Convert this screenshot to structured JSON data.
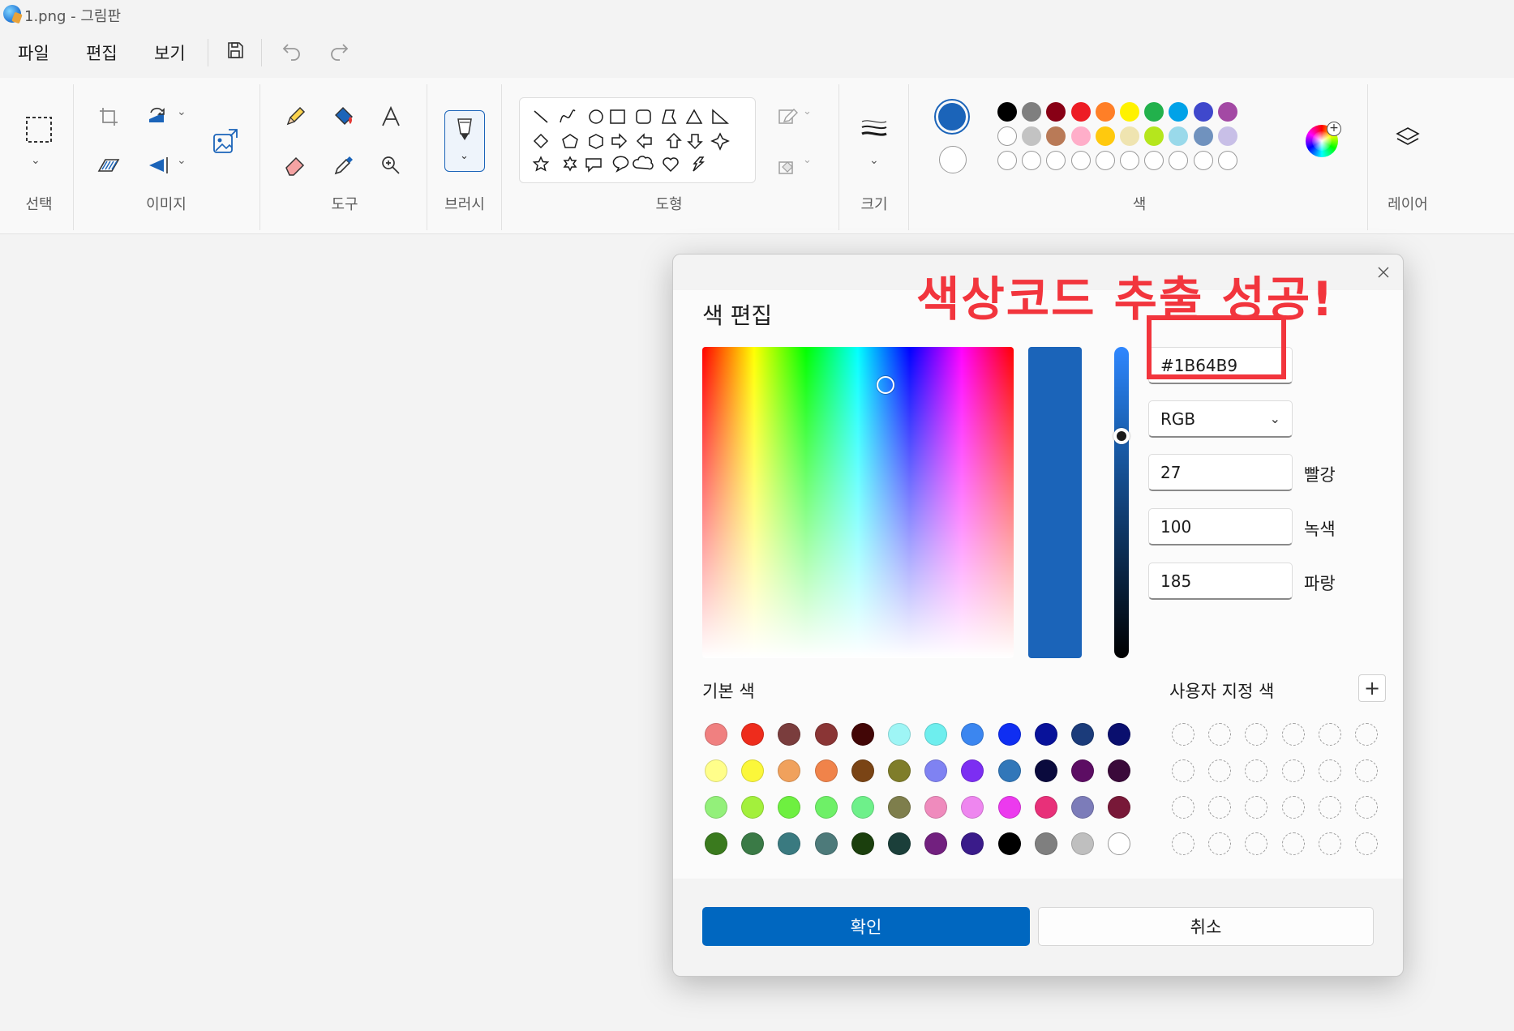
{
  "window": {
    "title": "1.png - 그림판"
  },
  "menu": {
    "file": "파일",
    "edit": "편집",
    "view": "보기"
  },
  "ribbon": {
    "groups": {
      "select": "선택",
      "image": "이미지",
      "tools": "도구",
      "brush": "브러시",
      "shapes": "도형",
      "size": "크기",
      "colors": "색",
      "layers": "레이어"
    }
  },
  "palette": {
    "primary": "#1b64b9",
    "secondary": "#ffffff",
    "row1": [
      "#000000",
      "#7f7f7f",
      "#880015",
      "#ed1c24",
      "#ff7f27",
      "#fff200",
      "#22b14c",
      "#00a2e8",
      "#3f48cc",
      "#a349a4"
    ],
    "row2": [
      "#ffffff",
      "#c3c3c3",
      "#b97a57",
      "#ffaec9",
      "#ffc90e",
      "#efe4b0",
      "#b5e61d",
      "#99d9ea",
      "#7092be",
      "#c8bfe7"
    ],
    "row3_count": 10
  },
  "dialog": {
    "title": "색 편집",
    "annotation": "색상코드 추출 성공!",
    "hex": "#1B64B9",
    "mode": "RGB",
    "red": {
      "value": "27",
      "label": "빨강"
    },
    "green": {
      "value": "100",
      "label": "녹색"
    },
    "blue": {
      "value": "185",
      "label": "파랑"
    },
    "preview_color": "#1b64b9",
    "basic_colors_label": "기본 색",
    "custom_colors_label": "사용자 지정 색",
    "basic_colors": [
      [
        "#f08080",
        "#ee2c1c",
        "#7a3d3d",
        "#8a3535",
        "#420606",
        "#9ef5f5",
        "#6eeeee",
        "#3b86f0",
        "#0f2ef2",
        "#08129a",
        "#1b3b7a",
        "#0a0f6e"
      ],
      [
        "#fffe8a",
        "#fbf73a",
        "#f0a15c",
        "#f0834a",
        "#7a4415",
        "#7f7d2a",
        "#7f82f2",
        "#7c2ef2",
        "#3177b9",
        "#0a0a3d",
        "#5c0d63",
        "#3a0a3a"
      ],
      [
        "#93f07a",
        "#a3f03c",
        "#6ef040",
        "#6ef067",
        "#6ef08a",
        "#7e7e4c",
        "#ef8bbd",
        "#ee86ef",
        "#ec3aee",
        "#e83079",
        "#7c7cb9",
        "#781838"
      ],
      [
        "#3a7a1e",
        "#3a7a46",
        "#3a7a80",
        "#4d7a7a",
        "#1b3f0d",
        "#1b3f3a",
        "#72207f",
        "#3a1b8a",
        "#000000",
        "#7f7f7f",
        "#bfbfbf",
        "#ffffff"
      ]
    ],
    "ok": "확인",
    "cancel": "취소"
  }
}
